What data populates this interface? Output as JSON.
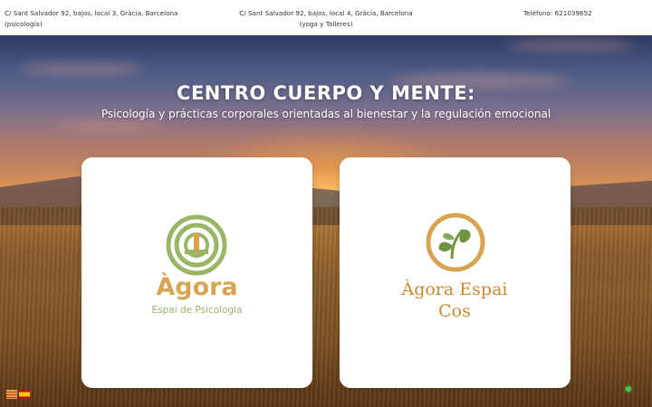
{
  "topbar": {
    "address_psicologia": "C/ Sant Salvador 92, bajos, local 3, Gràcia, Barcelona (psicología)",
    "address_yoga": "C/ Sant Salvador 92, bajos, local 4, Gràcia, Barcelona (yoga y Talleres)",
    "phone": "Teléfono: 621039652"
  },
  "hero": {
    "title": "CENTRO CUERPO Y MENTE:",
    "subtitle": "Psicología y prácticas corporales orientadas al bienestar y la regulación emocional"
  },
  "cards": {
    "psicologia": {
      "name": "Àgora",
      "subtitle": "Espai de Psicologia",
      "icon": "agora-psicologia-logo-icon",
      "colors": {
        "name": "#d9a452",
        "subtitle": "#9ab564",
        "ring": "#9ab564"
      }
    },
    "cos": {
      "name": "Àgora Espai Cos",
      "icon": "agora-espai-cos-leaf-logo-icon",
      "colors": {
        "name": "#c98a2e",
        "ring": "#d9a452",
        "leaf": "#6f9440"
      }
    }
  },
  "language_switcher": {
    "options": [
      "ca-flag-icon",
      "es-flag-icon"
    ]
  },
  "status": {
    "icon": "online-dot-icon",
    "color": "#3ecf4a"
  }
}
